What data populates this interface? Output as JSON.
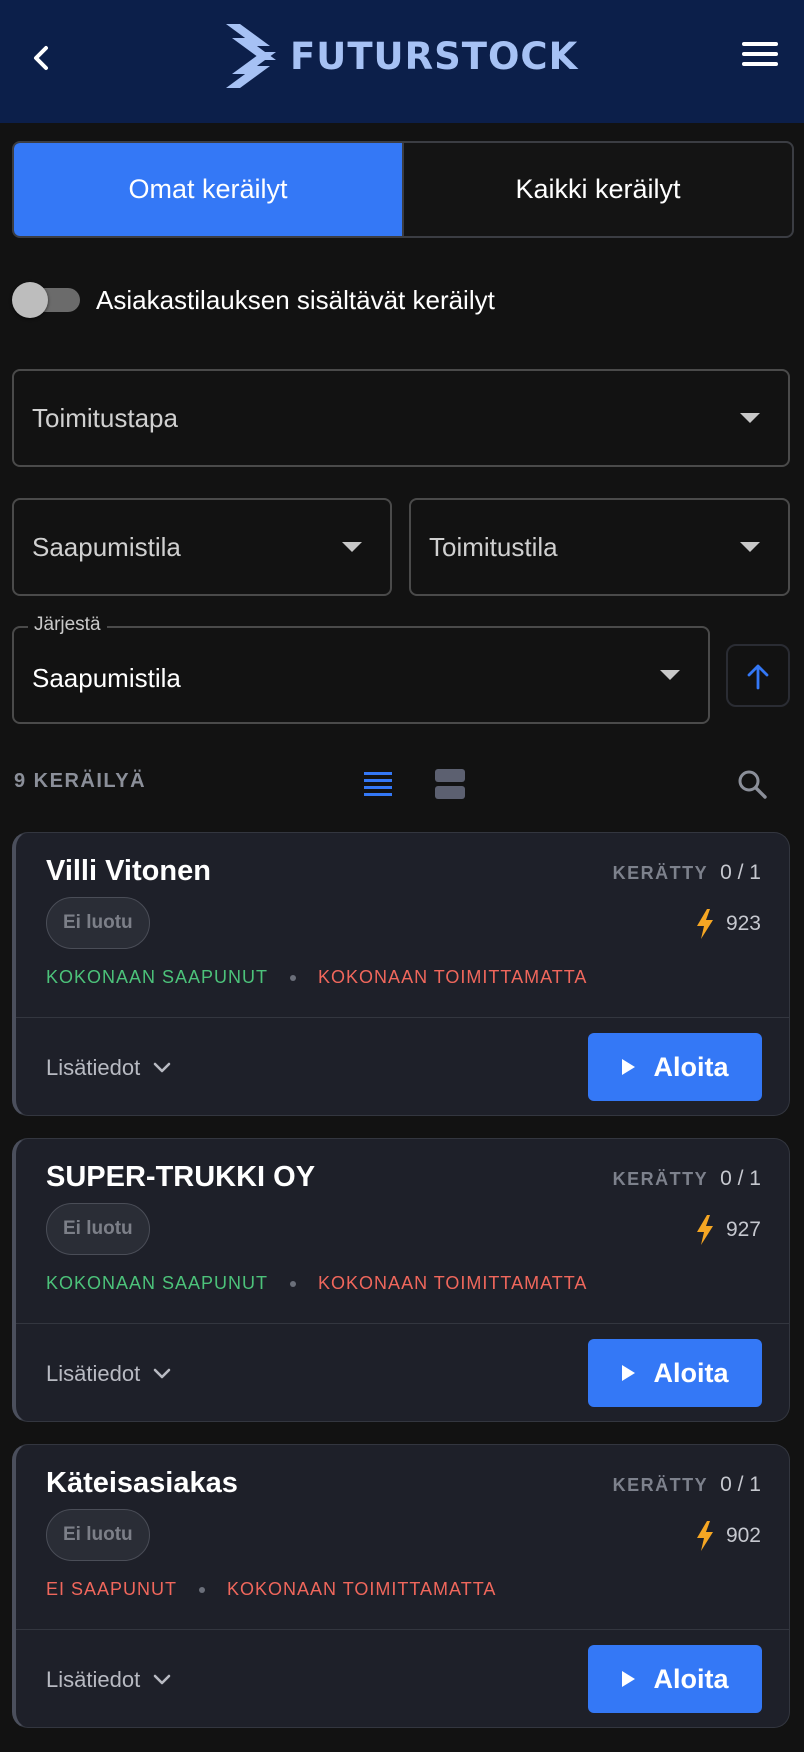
{
  "header": {
    "back_icon": "chevron-left-icon",
    "logo_text": "FUTURSTOCK",
    "menu_icon": "hamburger-menu-icon",
    "background": "#0c1f4a"
  },
  "tabs": [
    {
      "label": "Omat keräilyt",
      "active": true
    },
    {
      "label": "Kaikki keräilyt",
      "active": false
    }
  ],
  "toggle": {
    "label": "Asiakastilauksen sisältävät keräilyt",
    "checked": false
  },
  "filters": {
    "delivery_method": {
      "value": "Toimitustapa"
    },
    "arrival_status": {
      "value": "Saapumistila"
    },
    "delivery_status": {
      "value": "Toimitustila"
    },
    "sort": {
      "legend": "Järjestä",
      "value": "Saapumistila",
      "direction_icon": "arrow-up-icon"
    }
  },
  "list_header": {
    "count_text": "9 KERÄILYÄ",
    "view_mode": "list"
  },
  "colors": {
    "accent": "#3478f6",
    "ok": "#4cc27a",
    "error": "#f0675c",
    "priority": "#f5a623"
  },
  "cards": [
    {
      "name": "Villi Vitonen",
      "collected_label": "KERÄTTY",
      "collected_value": "0 / 1",
      "badge": "Ei luotu",
      "priority_value": "923",
      "arrival_status": "KOKONAAN SAAPUNUT",
      "delivery_status": "KOKONAAN TOIMITTAMATTA",
      "details_label": "Lisätiedot",
      "start_label": "Aloita"
    },
    {
      "name": "SUPER-TRUKKI OY",
      "collected_label": "KERÄTTY",
      "collected_value": "0 / 1",
      "badge": "Ei luotu",
      "priority_value": "927",
      "arrival_status": "KOKONAAN SAAPUNUT",
      "delivery_status": "KOKONAAN TOIMITTAMATTA",
      "details_label": "Lisätiedot",
      "start_label": "Aloita"
    },
    {
      "name": "Käteisasiakas",
      "collected_label": "KERÄTTY",
      "collected_value": "0 / 1",
      "badge": "Ei luotu",
      "priority_value": "902",
      "arrival_status": "EI SAAPUNUT",
      "delivery_status": "KOKONAAN TOIMITTAMATTA",
      "details_label": "Lisätiedot",
      "start_label": "Aloita"
    }
  ]
}
